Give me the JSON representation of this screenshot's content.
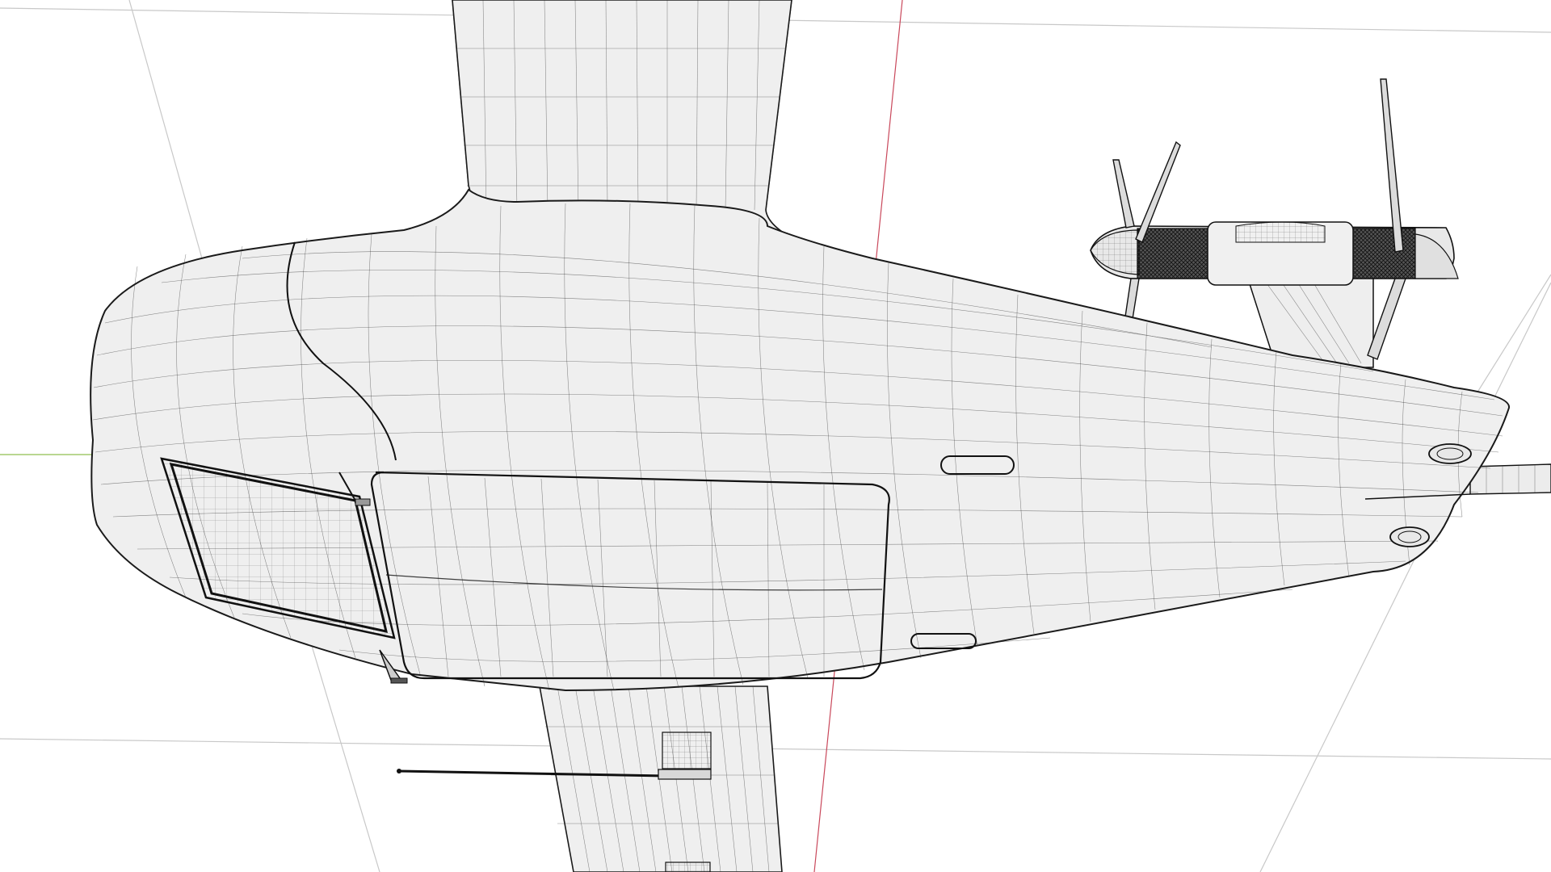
{
  "viewport": {
    "background": "#ffffff",
    "grid_color": "#c8c8c8",
    "axis_x_color": "#c9485b",
    "axis_y_color": "#8fbf4f",
    "surface_fill": "#efefef",
    "wire_color": "#1a1a1a",
    "display_mode": "wireframe-shaded"
  },
  "model": {
    "parts": [
      "fuselage",
      "wing-upper",
      "wing-lower",
      "nose-cap",
      "payload-hatch",
      "side-panel",
      "twin-rotor-nacelle",
      "tail-boom",
      "antenna"
    ]
  }
}
